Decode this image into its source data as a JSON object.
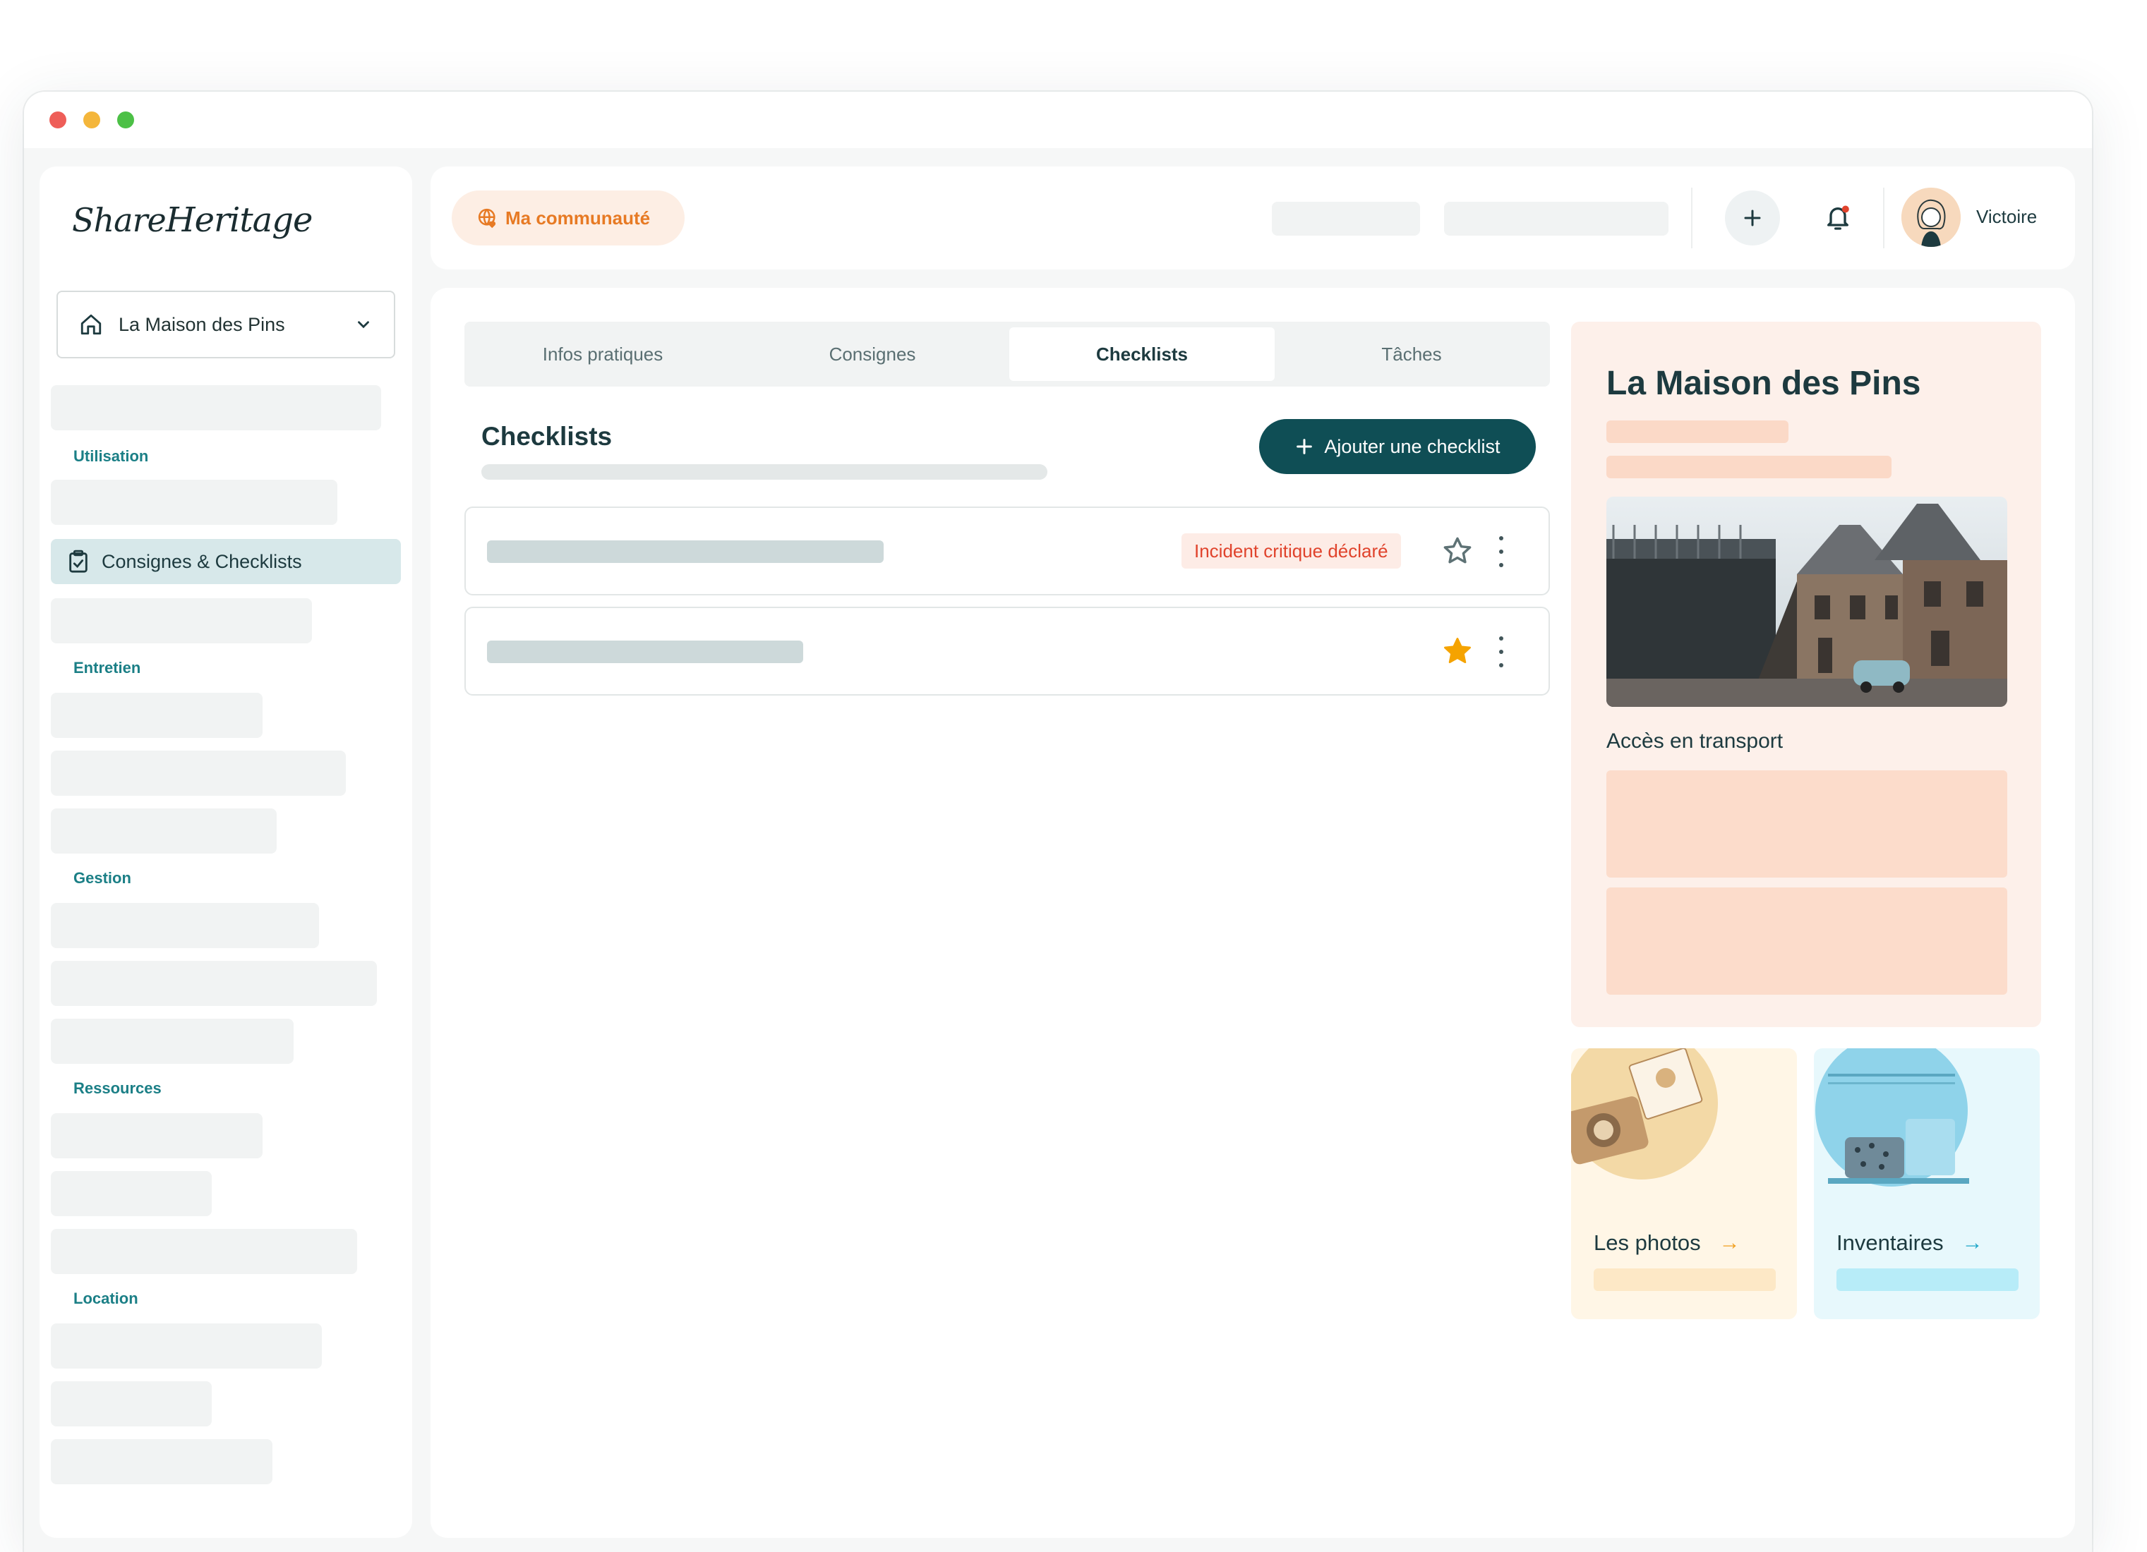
{
  "window": {
    "controls": [
      "close",
      "minimize",
      "maximize"
    ]
  },
  "brand": {
    "logo_part1": "Share",
    "logo_part2": "Heritage"
  },
  "sidebar": {
    "house_select": {
      "value": "La Maison des Pins",
      "icon": "home-icon"
    },
    "sections": [
      {
        "title": "Utilisation"
      },
      {
        "title": "Entretien"
      },
      {
        "title": "Gestion"
      },
      {
        "title": "Ressources"
      },
      {
        "title": "Location"
      }
    ],
    "active_item": {
      "label": "Consignes & Checklists",
      "icon": "clipboard-check-icon"
    }
  },
  "topbar": {
    "community_label": "Ma communauté",
    "user_name": "Victoire",
    "accent": "#e77a24"
  },
  "tabs": [
    {
      "label": "Infos pratiques",
      "active": false
    },
    {
      "label": "Consignes",
      "active": false
    },
    {
      "label": "Checklists",
      "active": true
    },
    {
      "label": "Tâches",
      "active": false
    }
  ],
  "checklists": {
    "title": "Checklists",
    "add_button": "Ajouter une checklist",
    "items": [
      {
        "badge": "Incident critique déclaré",
        "starred": false
      },
      {
        "badge": "",
        "starred": true
      }
    ]
  },
  "info_panel": {
    "title": "La Maison des Pins",
    "transport_label": "Accès en transport"
  },
  "quick_links": [
    {
      "label": "Les photos",
      "arrow": "→",
      "arrow_color": "#f0a020"
    },
    {
      "label": "Inventaires",
      "arrow": "→",
      "arrow_color": "#1ea6c8"
    }
  ],
  "colors": {
    "primary": "#0f4e55",
    "teal_label": "#1b7f86",
    "danger": "#e0432c",
    "star": "#f5a300"
  }
}
